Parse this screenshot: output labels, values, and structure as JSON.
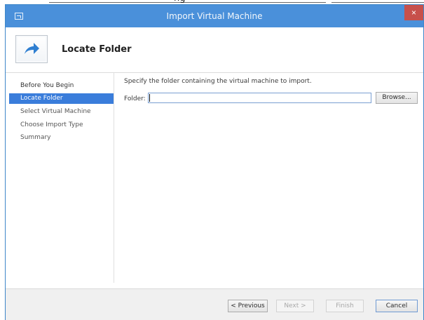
{
  "background": {
    "partial_text": "ng"
  },
  "window": {
    "title": "Import Virtual Machine",
    "close_glyph": "×",
    "title_color": "#4a90da",
    "close_color": "#c7504b"
  },
  "header": {
    "title": "Locate Folder",
    "icon": "arrow-right-icon"
  },
  "nav": {
    "items": [
      {
        "label": "Before You Begin",
        "state": "done"
      },
      {
        "label": "Locate Folder",
        "state": "active"
      },
      {
        "label": "Select Virtual Machine",
        "state": "pending"
      },
      {
        "label": "Choose Import Type",
        "state": "pending"
      },
      {
        "label": "Summary",
        "state": "pending"
      }
    ],
    "active_color": "#3a7ddb"
  },
  "main": {
    "instructions": "Specify the folder containing the virtual machine to import.",
    "folder_label": "Folder:",
    "folder_value": "",
    "browse_label": "Browse..."
  },
  "footer": {
    "previous_label": "< Previous",
    "next_label": "Next >",
    "finish_label": "Finish",
    "cancel_label": "Cancel"
  }
}
